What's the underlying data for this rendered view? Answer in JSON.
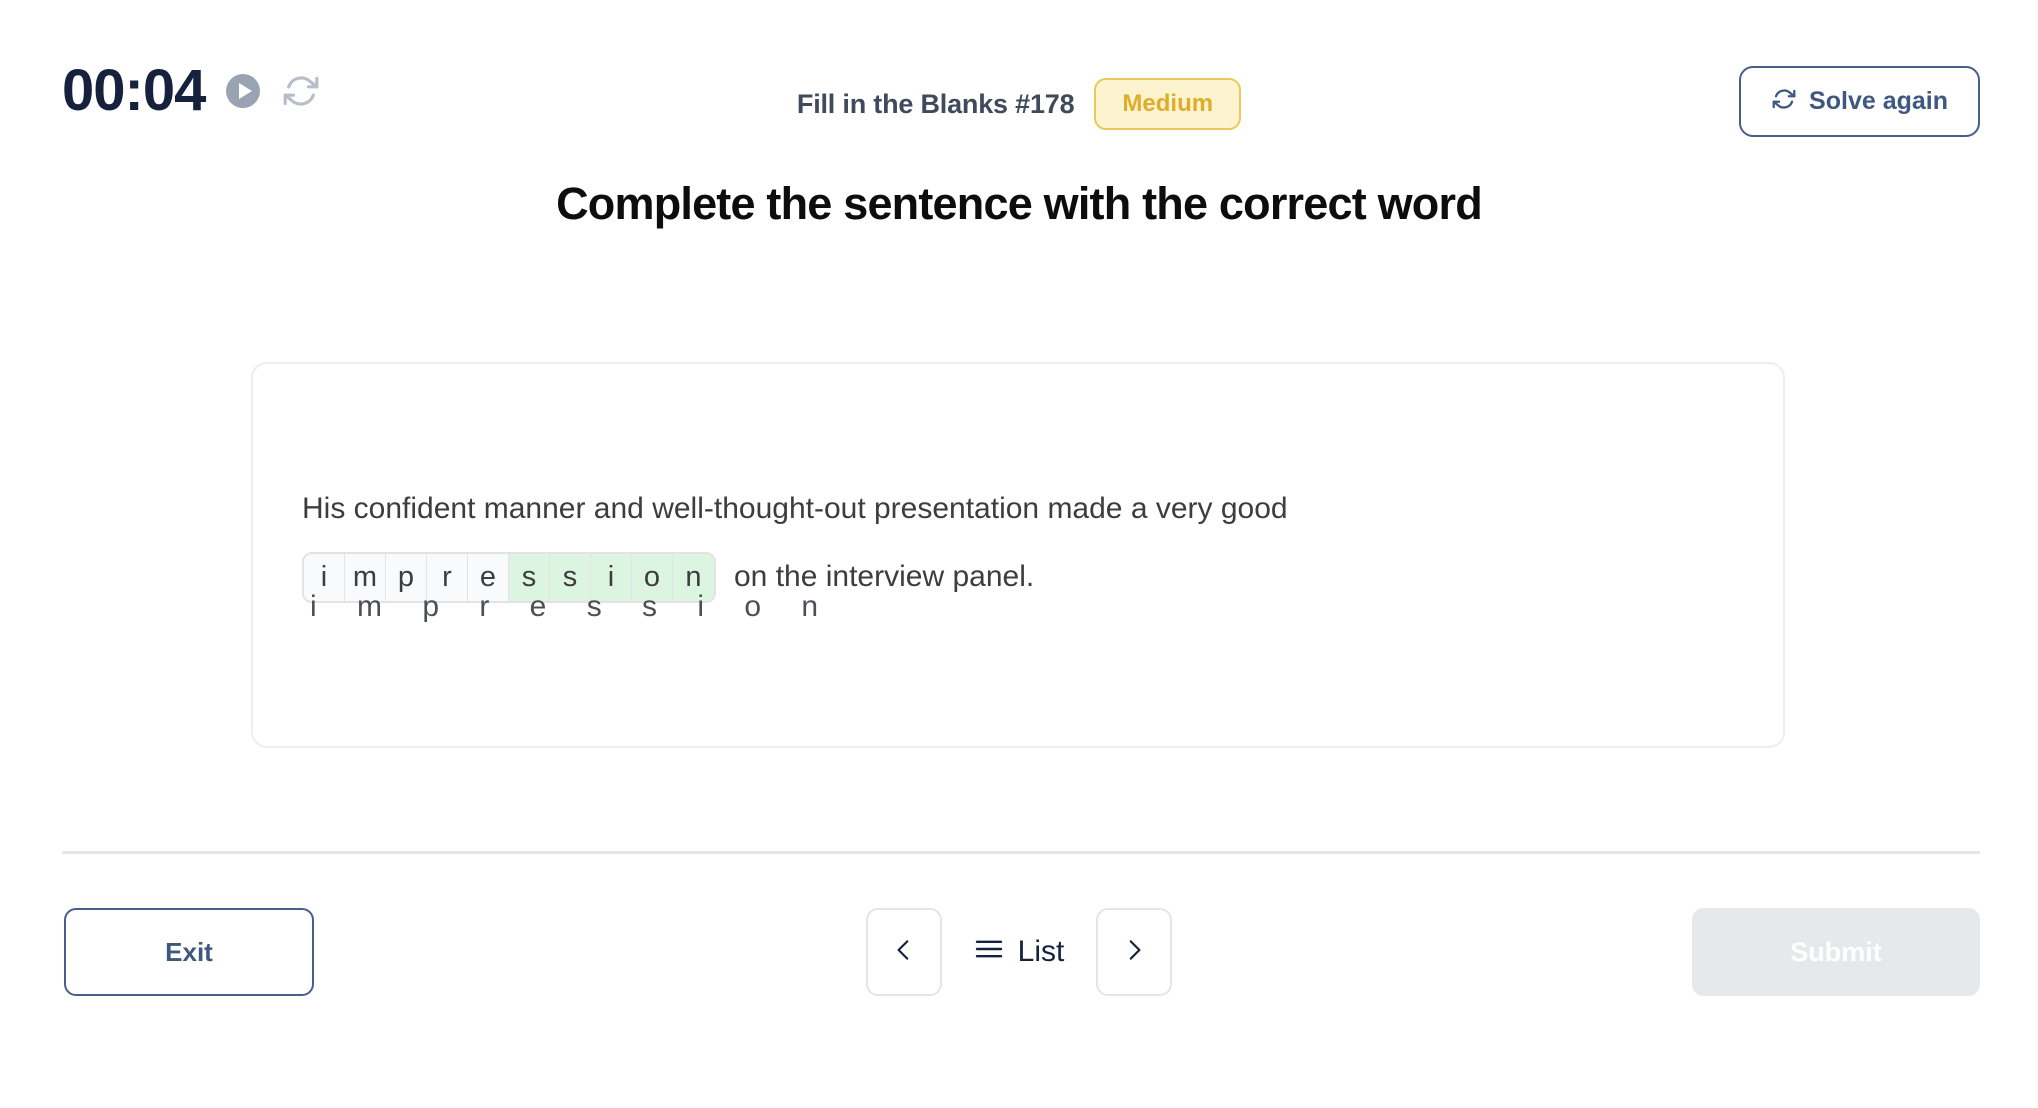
{
  "header": {
    "timer": "00:04",
    "play_icon": "play-circle-icon",
    "reset_icon": "refresh-icon",
    "puzzle_title": "Fill in the Blanks #178",
    "difficulty_badge": "Medium",
    "solve_again_label": "Solve again",
    "solve_again_icon": "refresh-icon",
    "badge_color": "#e0ac2b",
    "accent_color": "#46608c"
  },
  "heading": "Complete the sentence with the correct word",
  "question": {
    "sentence_before": "His confident manner and well-thought-out presentation made a very good",
    "sentence_after": "on the interview panel.",
    "answer_word": "impression",
    "word_hint": "i m p r e s s i o n",
    "letters": [
      {
        "char": "i",
        "filled": false
      },
      {
        "char": "m",
        "filled": false
      },
      {
        "char": "p",
        "filled": false
      },
      {
        "char": "r",
        "filled": false
      },
      {
        "char": "e",
        "filled": false
      },
      {
        "char": "s",
        "filled": true
      },
      {
        "char": "s",
        "filled": true
      },
      {
        "char": "i",
        "filled": true
      },
      {
        "char": "o",
        "filled": true
      },
      {
        "char": "n",
        "filled": true
      }
    ],
    "filled_color": "#dcf5e1"
  },
  "footer": {
    "exit_label": "Exit",
    "prev_icon": "chevron-left-icon",
    "list_icon": "hamburger-icon",
    "list_label": "List",
    "next_icon": "chevron-right-icon",
    "submit_label": "Submit",
    "submit_disabled": true
  }
}
